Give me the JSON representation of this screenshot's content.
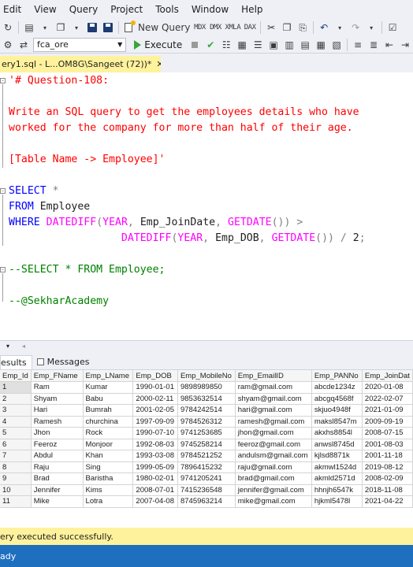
{
  "menu": [
    "Edit",
    "View",
    "Query",
    "Project",
    "Tools",
    "Window",
    "Help"
  ],
  "toolbar": {
    "new_query_label": "New Query",
    "database": "fca_ore",
    "execute_label": "Execute",
    "small_icons": [
      "MDX",
      "DMX",
      "XMLA",
      "DAX"
    ]
  },
  "tab": {
    "title": "ery1.sql - L...OM8G\\Sangeet (72))*",
    "close": "✕"
  },
  "editor": {
    "line1": "'# Question-108:",
    "line2": "Write an SQL query to get the employees details who have",
    "line3": "worked for the company for more than half of their age.",
    "line4": "[Table Name -> Employee]'",
    "select_kw": "SELECT",
    "star": "*",
    "from_kw": "FROM",
    "table": "Employee",
    "where_kw": "WHERE",
    "datediff": "DATEDIFF",
    "year": "YEAR",
    "join_col": "Emp_JoinDate",
    "getdate": "GETDATE",
    "dob_col": "Emp_DOB",
    "comment1": "--SELECT * FROM Employee;",
    "comment2": "--@SekharAcademy"
  },
  "results": {
    "tab_results": "esults",
    "tab_messages": "Messages",
    "columns": [
      "Emp_Id",
      "Emp_FName",
      "Emp_LName",
      "Emp_DOB",
      "Emp_MobileNo",
      "Emp_EmailID",
      "Emp_PANNo",
      "Emp_JoinDat"
    ],
    "rows": [
      [
        "1",
        "Ram",
        "Kumar",
        "1990-01-01",
        "9898989850",
        "ram@gmail.com",
        "abcde1234z",
        "2020-01-08"
      ],
      [
        "2",
        "Shyam",
        "Babu",
        "2000-02-11",
        "9853632514",
        "shyam@gmail.com",
        "abcgq4568f",
        "2022-02-07"
      ],
      [
        "3",
        "Hari",
        "Bumrah",
        "2001-02-05",
        "9784242514",
        "hari@gmail.com",
        "skjuo4948f",
        "2021-01-09"
      ],
      [
        "4",
        "Ramesh",
        "churchina",
        "1997-09-09",
        "9784526312",
        "ramesh@gmail.com",
        "maksl8547m",
        "2009-09-19"
      ],
      [
        "5",
        "Jhon",
        "Rock",
        "1990-07-10",
        "9741253685",
        "jhon@gmail.com",
        "akxhs8854l",
        "2008-07-15"
      ],
      [
        "6",
        "Feeroz",
        "Monjoor",
        "1992-08-03",
        "9745258214",
        "feeroz@gmail.com",
        "anwsl8745d",
        "2001-08-03"
      ],
      [
        "7",
        "Abdul",
        "Khan",
        "1993-03-08",
        "9784521252",
        "andulsm@gmail.com",
        "kjlsd8871k",
        "2001-11-18"
      ],
      [
        "8",
        "Raju",
        "Sing",
        "1999-05-09",
        "7896415232",
        "raju@gmail.com",
        "akmwl1524d",
        "2019-08-12"
      ],
      [
        "9",
        "Brad",
        "Baristha",
        "1980-02-01",
        "9741205241",
        "brad@gmail.com",
        "akmld2571d",
        "2008-02-09"
      ],
      [
        "10",
        "Jennifer",
        "Kims",
        "2008-07-01",
        "7415236548",
        "jennifer@gmail.com",
        "hhnjh6547k",
        "2018-11-08"
      ],
      [
        "11",
        "Mike",
        "Lotra",
        "2007-04-08",
        "8745963214",
        "mike@gmail.com",
        "hjkml5478l",
        "2021-04-22"
      ]
    ]
  },
  "status": {
    "message": "ery executed successfully.",
    "ready": "ady"
  }
}
